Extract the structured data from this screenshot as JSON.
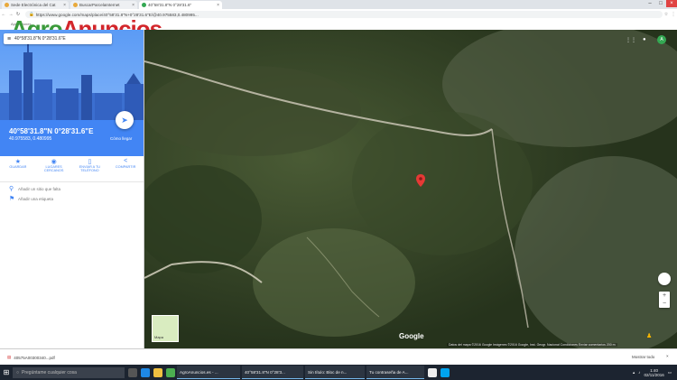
{
  "browser": {
    "tabs": [
      {
        "label": "Sede Electrónica del Cat"
      },
      {
        "label": "BuscarParcelaInternet"
      },
      {
        "label": "40°58'31.8\"N 0°28'31.6\""
      }
    ],
    "url": "https://www.google.com/maps/place/40°58'31.8\"N+0°28'31.6\"E/@40.975583,0.480995...",
    "bookmarks_label": "Aplicaciones"
  },
  "logo": {
    "part1": "Agro",
    "part2": "Anuncios"
  },
  "panel": {
    "search_value": "40°58'31.8\"N 0°28'31.6\"E",
    "coords_dms": "40°58'31.8\"N 0°28'31.6\"E",
    "coords_decimal": "40.975583, 0.480995",
    "directions_label": "Cómo llegar",
    "actions": [
      {
        "icon": "star-icon",
        "glyph": "★",
        "label": "GUARDAR"
      },
      {
        "icon": "nearby-icon",
        "glyph": "◉",
        "label": "LUGARES CERCANOS"
      },
      {
        "icon": "phone-icon",
        "glyph": "▯",
        "label": "ENVIAR A TU TELÉFONO"
      },
      {
        "icon": "share-icon",
        "glyph": "<",
        "label": "COMPARTIR"
      }
    ],
    "add_missing_place": "Añadir un sitio que falta",
    "add_label": "Añadir una etiqueta"
  },
  "map": {
    "google_label": "Google",
    "attribution": "Datos del mapa ©2016 Google Imágenes ©2016 Google, Inst. Geogr. Nacional   Condiciones   Enviar comentarios   200 m",
    "layer_label": "Mapa",
    "colors": {
      "pin": "#e53935",
      "terrain": "#2d3a22"
    }
  },
  "download": {
    "file": "40575A00300340...pdf",
    "show_all": "Mostrar todo"
  },
  "taskbar": {
    "search_placeholder": "Pregúntame cualquier cosa",
    "apps": [
      {
        "label": "AgroAnuncios.es - ..."
      },
      {
        "label": "40°58'31.8\"N 0°28'3..."
      },
      {
        "label": "Sin título: Bloc de n..."
      },
      {
        "label": "Tu contraseña de A..."
      }
    ],
    "time": "1:40",
    "date": "02/11/2016"
  }
}
